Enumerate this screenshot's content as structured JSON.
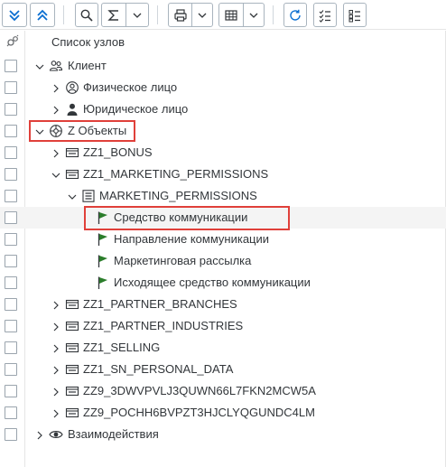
{
  "toolbar": {
    "buttons": [
      {
        "name": "expand-all-button",
        "icon": "double-chevron-down-icon"
      },
      {
        "name": "collapse-all-button",
        "icon": "double-chevron-up-icon"
      },
      {
        "name": "search-button",
        "icon": "search-icon"
      },
      {
        "name": "sum-button",
        "icon": "sum-icon"
      },
      {
        "name": "print-button",
        "icon": "printer-icon"
      },
      {
        "name": "table-settings-button",
        "icon": "table-icon"
      },
      {
        "name": "refresh-button",
        "icon": "refresh-icon"
      },
      {
        "name": "select-all-button",
        "icon": "checklist-icon"
      },
      {
        "name": "deselect-all-button",
        "icon": "checklist-icon"
      }
    ]
  },
  "tree": {
    "header": "Список узлов",
    "rows": [
      {
        "label": "Клиент",
        "icon": "people-icon",
        "chevron": "down",
        "level": 0
      },
      {
        "label": "Физическое лицо",
        "icon": "person-circle-icon",
        "chevron": "right",
        "level": 1
      },
      {
        "label": "Юридическое лицо",
        "icon": "person-icon",
        "chevron": "right",
        "level": 1
      },
      {
        "label": "Z Объекты",
        "icon": "network-icon",
        "chevron": "down",
        "level": 0
      },
      {
        "label": "ZZ1_BONUS",
        "icon": "table-object-icon",
        "chevron": "right",
        "level": 1
      },
      {
        "label": "ZZ1_MARKETING_PERMISSIONS",
        "icon": "table-object-icon",
        "chevron": "down",
        "level": 1
      },
      {
        "label": "MARKETING_PERMISSIONS",
        "icon": "list-icon",
        "chevron": "down",
        "level": 2
      },
      {
        "label": "Средство коммуникации",
        "icon": "flag-icon",
        "chevron": "none",
        "level": 3
      },
      {
        "label": "Направление коммуникации",
        "icon": "flag-icon",
        "chevron": "none",
        "level": 3
      },
      {
        "label": "Маркетинговая рассылка",
        "icon": "flag-icon",
        "chevron": "none",
        "level": 3
      },
      {
        "label": "Исходящее средство коммуникации",
        "icon": "flag-icon",
        "chevron": "none",
        "level": 3
      },
      {
        "label": "ZZ1_PARTNER_BRANCHES",
        "icon": "table-object-icon",
        "chevron": "right",
        "level": 1
      },
      {
        "label": "ZZ1_PARTNER_INDUSTRIES",
        "icon": "table-object-icon",
        "chevron": "right",
        "level": 1
      },
      {
        "label": "ZZ1_SELLING",
        "icon": "table-object-icon",
        "chevron": "right",
        "level": 1
      },
      {
        "label": "ZZ1_SN_PERSONAL_DATA",
        "icon": "table-object-icon",
        "chevron": "right",
        "level": 1
      },
      {
        "label": "ZZ9_3DWVPVLJ3QUWN66L7FKN2MCW5A",
        "icon": "table-object-icon",
        "chevron": "right",
        "level": 1
      },
      {
        "label": "ZZ9_POCHH6BVPZT3HJCLYQGUNDC4LM",
        "icon": "table-object-icon",
        "chevron": "right",
        "level": 1
      },
      {
        "label": "Взаимодействия",
        "icon": "eye-icon",
        "chevron": "right",
        "level": 0
      }
    ]
  },
  "colors": {
    "accent": "#0a6ed1",
    "highlight": "#e0403a",
    "flag": "#2b7d2b",
    "selected_row": "#f4f4f4"
  }
}
